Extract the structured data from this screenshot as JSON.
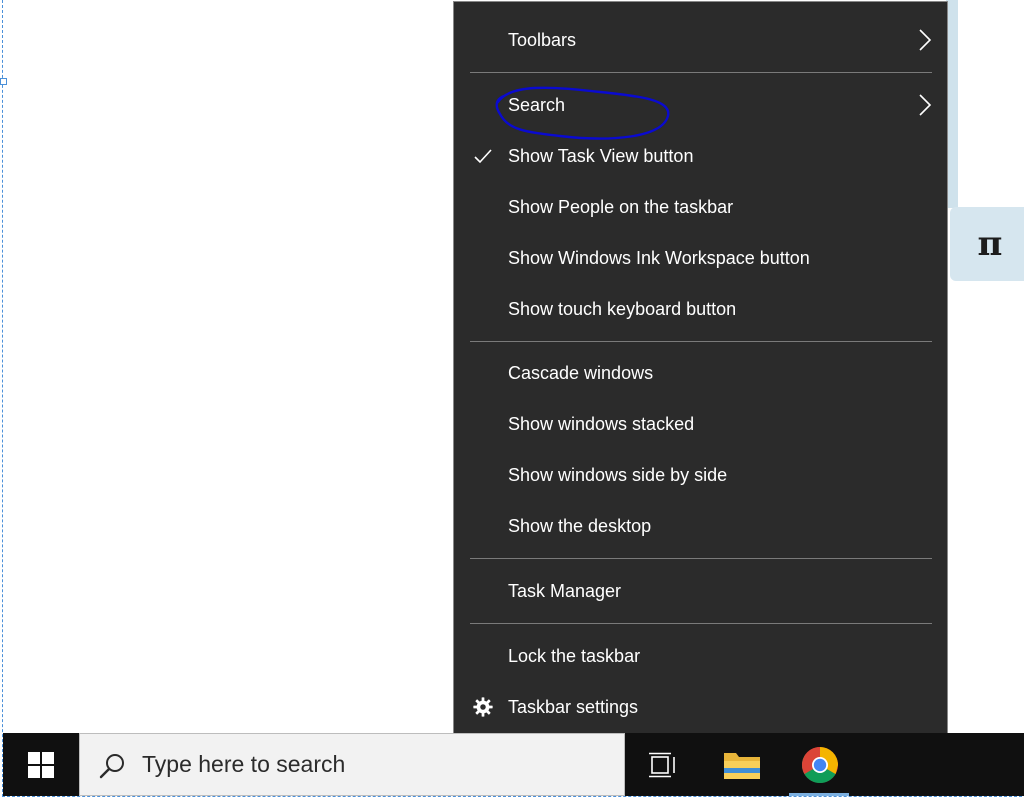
{
  "menu": {
    "items": [
      {
        "label": "Toolbars",
        "submenu": true
      },
      {
        "label": "Search",
        "submenu": true
      },
      {
        "label": "Show Task View button",
        "checked": true
      },
      {
        "label": "Show People on the taskbar"
      },
      {
        "label": "Show Windows Ink Workspace button"
      },
      {
        "label": "Show touch keyboard button"
      },
      {
        "label": "Cascade windows"
      },
      {
        "label": "Show windows stacked"
      },
      {
        "label": "Show windows side by side"
      },
      {
        "label": "Show the desktop"
      },
      {
        "label": "Task Manager"
      },
      {
        "label": "Lock the taskbar"
      },
      {
        "label": "Taskbar settings",
        "icon": "gear-icon"
      }
    ]
  },
  "taskbar": {
    "search_placeholder": "Type here to search",
    "icons": [
      "windows-logo-icon",
      "search-icon",
      "task-view-icon",
      "file-explorer-icon",
      "chrome-icon"
    ]
  },
  "background": {
    "pi_symbol": "π"
  },
  "colors": {
    "menu_bg": "#2b2b2b",
    "taskbar_bg": "#101010",
    "annotation": "#0a0ad0"
  }
}
